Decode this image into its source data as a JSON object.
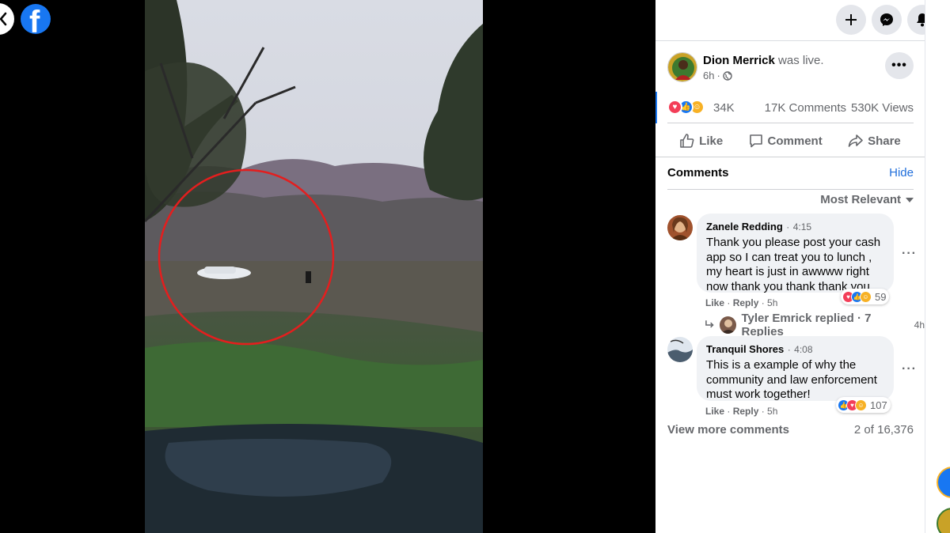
{
  "topbar": {
    "create_icon": "plus-icon",
    "messenger_icon": "messenger-icon",
    "notifications_icon": "bell-icon"
  },
  "post": {
    "author": "Dion Merrick",
    "action": "was live.",
    "time": "6h",
    "audience_icon": "globe-icon",
    "reactions_count": "34K",
    "comments_count": "17K Comments",
    "views_count": "530K Views"
  },
  "actions": {
    "like": "Like",
    "comment": "Comment",
    "share": "Share"
  },
  "comments_header": {
    "title": "Comments",
    "hide": "Hide",
    "sort": "Most Relevant"
  },
  "comments": [
    {
      "name": "Zanele Redding",
      "timestamp": "4:15",
      "text": "Thank you please post your cash app so I can treat you to lunch , my heart is just in awwww right now thank you thank thank you",
      "reactions": "59",
      "like": "Like",
      "reply": "Reply",
      "age": "5h"
    },
    {
      "name": "Tranquil Shores",
      "timestamp": "4:08",
      "text": "This is a example of why the community and law enforcement must work together!",
      "reactions": "107",
      "like": "Like",
      "reply": "Reply",
      "age": "5h"
    }
  ],
  "reply_summary": {
    "text": "Tyler Emrick replied · 7 Replies",
    "time": "4h"
  },
  "footer": {
    "view_more": "View more comments",
    "count": "2 of 16,376"
  },
  "colors": {
    "brand": "#1877f2",
    "love": "#f33e58",
    "care": "#f7b125",
    "highlight": "#e41e1e"
  }
}
